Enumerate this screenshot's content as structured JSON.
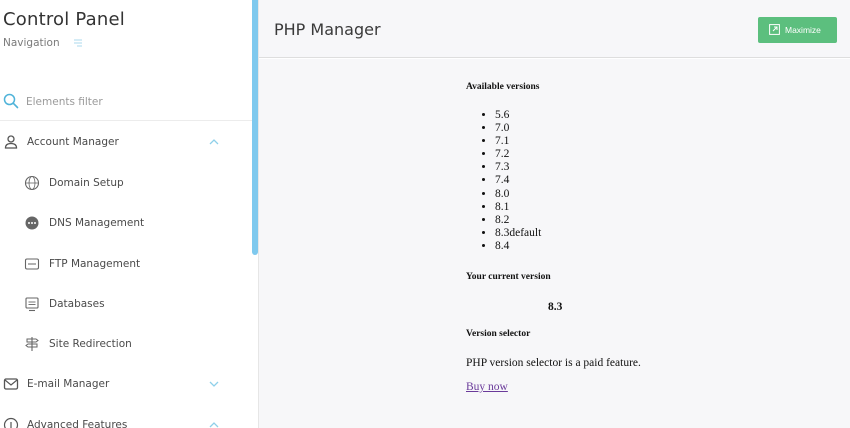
{
  "sidebar": {
    "title": "Control Panel",
    "subtitle": "Navigation",
    "filter_placeholder": "Elements filter",
    "items": [
      {
        "label": "Account Manager",
        "icon": "user-icon",
        "expanded": true,
        "children": [
          {
            "label": "Domain Setup",
            "icon": "www-icon"
          },
          {
            "label": "DNS Management",
            "icon": "dns-icon"
          },
          {
            "label": "FTP Management",
            "icon": "ftp-icon"
          },
          {
            "label": "Databases",
            "icon": "database-icon"
          },
          {
            "label": "Site Redirection",
            "icon": "signpost-icon"
          }
        ]
      },
      {
        "label": "E-mail Manager",
        "icon": "envelope-icon",
        "expanded": false
      },
      {
        "label": "Advanced Features",
        "icon": "advanced-icon",
        "expanded": true
      }
    ]
  },
  "header": {
    "title": "PHP Manager",
    "maximize_label": "Maximize"
  },
  "main": {
    "available_heading": "Available versions",
    "versions": [
      "5.6",
      "7.0",
      "7.1",
      "7.2",
      "7.3",
      "7.4",
      "8.0",
      "8.1",
      "8.2",
      "8.3default",
      "8.4"
    ],
    "current_heading": "Your current version",
    "current_version": "8.3",
    "selector_heading": "Version selector",
    "selector_note": "PHP version selector is a paid feature.",
    "buy_link": "Buy now"
  },
  "colors": {
    "accent": "#4fb3d9",
    "scrollbar": "#7fc9ee",
    "maximize_button": "#5cbf7e",
    "link": "#6a3a9a",
    "content_bg": "#f7f7f9"
  }
}
